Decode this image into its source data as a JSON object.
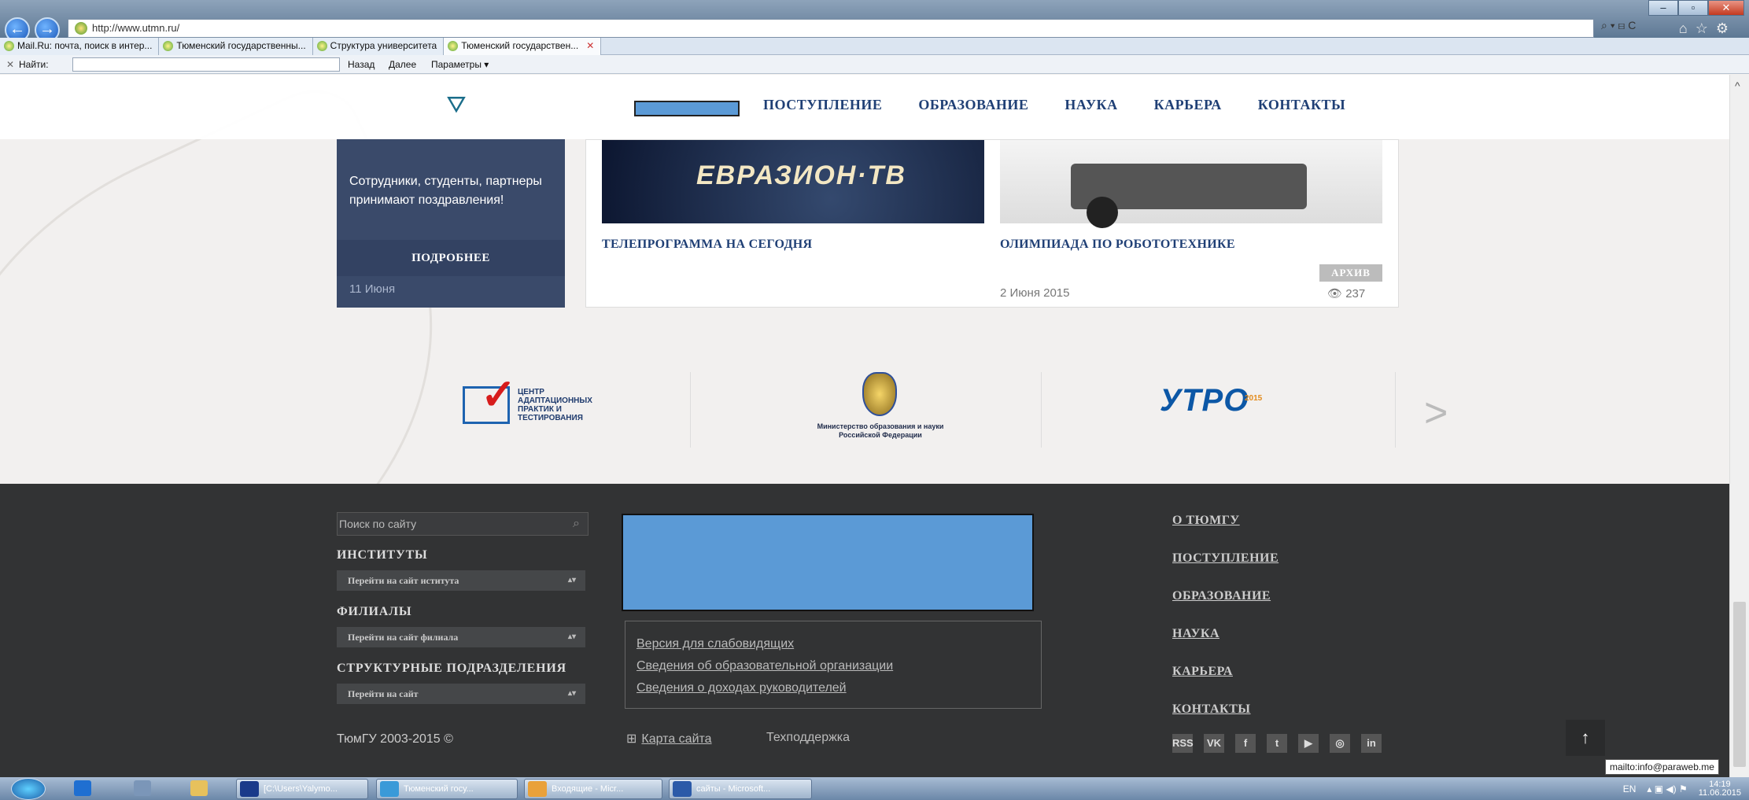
{
  "browser": {
    "address": "http://www.utmn.ru/",
    "address_tools": "⌕ ▾ ⊟ C",
    "tabs": [
      {
        "label": "Mail.Ru: почта, поиск в интер..."
      },
      {
        "label": "Тюменский государственны..."
      },
      {
        "label": "Структура университета"
      },
      {
        "label": "Тюменский государствен...",
        "close": "✕"
      }
    ],
    "find": {
      "close": "✕",
      "label": "Найти:",
      "value": "",
      "prev": "Назад",
      "next": "Далее",
      "options": "Параметры ▾"
    }
  },
  "header": {
    "menu": [
      "ПОСТУПЛЕНИЕ",
      "ОБРАЗОВАНИЕ",
      "НАУКА",
      "КАРЬЕРА",
      "КОНТАКТЫ"
    ]
  },
  "news": {
    "left_text": "Сотрудники, студенты, партнеры принимают поздравления!",
    "left_more": "ПОДРОБНЕЕ",
    "left_date": "11 Июня",
    "card1_image_text": "ЕВРАЗИОН·ТВ",
    "card1_title": "ТЕЛЕПРОГРАММА НА СЕГОДНЯ",
    "card2_title": "ОЛИМПИАДА ПО РОБОТОТЕХНИКЕ",
    "archive": "АРХИВ",
    "card2_date": "2 Июня 2015",
    "card2_views": "237"
  },
  "partners": {
    "p1_lines": [
      "ЦЕНТР",
      "АДАПТАЦИОННЫХ",
      "ПРАКТИК И",
      "ТЕСТИРОВАНИЯ"
    ],
    "p2_caption": "Министерство образования и науки Российской Федерации",
    "p3_logo": "УТРО",
    "p3_year": "2015",
    "next": ">"
  },
  "footer": {
    "search_placeholder": "Поиск по сайту",
    "institutes": "ИНСТИТУТЫ",
    "institutes_select": "Перейти на сайт иститута",
    "branches": "ФИЛИАЛЫ",
    "branches_select": "Перейти на сайт филиала",
    "divisions": "СТРУКТУРНЫЕ ПОДРАЗДЕЛЕНИЯ",
    "divisions_select": "Перейти на сайт",
    "copyright": "ТюмГУ 2003-2015 ©",
    "links": [
      "Версия для слабовидящих",
      "Сведения об образовательной организации",
      "Сведения о доходах руководителей"
    ],
    "sitemap": "Карта сайта",
    "support": "Техподдержка",
    "nav": [
      "О ТЮМГУ",
      "ПОСТУПЛЕНИЕ",
      "ОБРАЗОВАНИЕ",
      "НАУКА",
      "КАРЬЕРА",
      "КОНТАКТЫ"
    ],
    "social": [
      "RSS",
      "VK",
      "f",
      "t",
      "▶",
      "◎",
      "in"
    ],
    "to_top": "↑"
  },
  "status": {
    "tooltip": "mailto:info@paraweb.me"
  },
  "taskbar": {
    "tasks": [
      "[C:\\Users\\Yalymo...",
      "Тюменский госу...",
      "Входящие - Micr...",
      "сайты - Microsoft..."
    ],
    "lang": "EN",
    "time": "14:19",
    "date": "11.06.2015"
  },
  "colors": {
    "menu": "#1f3f75",
    "footer_bg": "#323334",
    "placeholder_blue": "#5b9ad6"
  }
}
